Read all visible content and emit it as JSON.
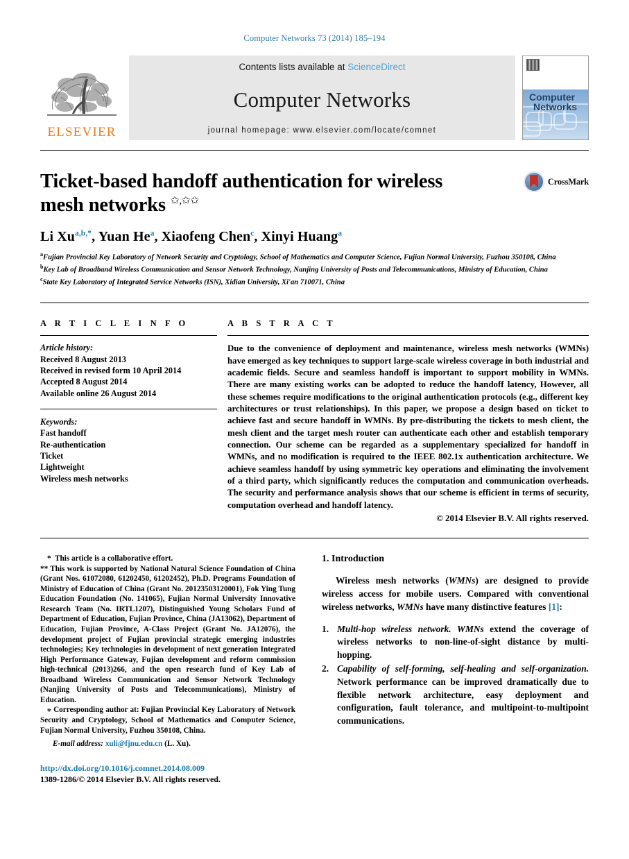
{
  "running_head": "Computer Networks 73 (2014) 185–194",
  "masthead": {
    "contents_prefix": "Contents lists available at ",
    "sciencedirect": "ScienceDirect",
    "journal_title": "Computer Networks",
    "homepage": "journal homepage: www.elsevier.com/locate/comnet",
    "publisher_word": "ELSEVIER",
    "cover_line1": "Computer",
    "cover_line2": "Networks",
    "crossmark_label": "CrossMark"
  },
  "title": {
    "text": "Ticket-based handoff authentication for wireless mesh networks",
    "footnote_marks": "✩,✩✩"
  },
  "authors": [
    {
      "name": "Li Xu",
      "sup": "a,b,",
      "star": "*"
    },
    {
      "name": "Yuan He",
      "sup": "a"
    },
    {
      "name": "Xiaofeng Chen",
      "sup": "c"
    },
    {
      "name": "Xinyi Huang",
      "sup": "a"
    }
  ],
  "affiliations": [
    {
      "mark": "a",
      "text": "Fujian Provincial Key Laboratory of Network Security and Cryptology, School of Mathematics and Computer Science, Fujian Normal University, Fuzhou 350108, China"
    },
    {
      "mark": "b",
      "text": "Key Lab of Broadband Wireless Communication and Sensor Network Technology, Nanjing University of Posts and Telecommunications, Ministry of Education, China"
    },
    {
      "mark": "c",
      "text": "State Key Laboratory of Integrated Service Networks (ISN), Xidian University, Xi'an 710071, China"
    }
  ],
  "article_info": {
    "heading": "A R T I C L E   I N F O",
    "history_label": "Article history:",
    "history": [
      "Received 8 August 2013",
      "Received in revised form 10 April 2014",
      "Accepted 8 August 2014",
      "Available online 26 August 2014"
    ],
    "keywords_label": "Keywords:",
    "keywords": [
      "Fast handoff",
      "Re-authentication",
      "Ticket",
      "Lightweight",
      "Wireless mesh networks"
    ]
  },
  "abstract": {
    "heading": "A B S T R A C T",
    "text": "Due to the convenience of deployment and maintenance, wireless mesh networks (WMNs) have emerged as key techniques to support large-scale wireless coverage in both industrial and academic fields. Secure and seamless handoff is important to support mobility in WMNs. There are many existing works can be adopted to reduce the handoff latency, However, all these schemes require modifications to the original authentication protocols (e.g., different key architectures or trust relationships). In this paper, we propose a design based on ticket to achieve fast and secure handoff in WMNs. By pre-distributing the tickets to mesh client, the mesh client and the target mesh router can authenticate each other and establish temporary connection. Our scheme can be regarded as a supplementary specialized for handoff in WMNs, and no modification is required to the IEEE 802.1x authentication architecture. We achieve seamless handoff by using symmetric key operations and eliminating the involvement of a third party, which significantly reduces the computation and communication overheads. The security and performance analysis shows that our scheme is efficient in terms of security, computation overhead and handoff latency.",
    "copyright": "© 2014 Elsevier B.V. All rights reserved."
  },
  "footnotes": {
    "star_mark": "*",
    "star_text": "This article is a collaborative effort.",
    "dstar_mark": "**",
    "dstar_text": "This work is supported by National Natural Science Foundation of China (Grant Nos. 61072080, 61202450, 61202452), Ph.D. Programs Foundation of Ministry of Education of China (Grant No. 20123503120001), Fok Ying Tung Education Foundation (No. 141065), Fujian Normal University Innovative Research Team (No. IRTL1207), Distinguished Young Scholars Fund of Department of Education, Fujian Province, China (JA13062), Department of Education, Fujian Province, A-Class Project (Grant No. JA12076), the development project of Fujian provincial strategic emerging industries technologies; Key technologies in development of next generation Integrated High Performance Gateway, Fujian development and reform commission high-technical (2013)266, and the open research fund of Key Lab of Broadband Wireless Communication and Sensor Network Technology (Nanjing University of Posts and Telecommunications), Ministry of Education.",
    "corresponding_mark": "⁎",
    "corresponding_text": "Corresponding author at: Fujian Provincial Key Laboratory of Network Security and Cryptology, School of Mathematics and Computer Science, Fujian Normal University, Fuzhou 350108, China.",
    "email_label": "E-mail address:",
    "email": "xuli@fjnu.edu.cn",
    "email_suffix": "(L. Xu)."
  },
  "doi": "http://dx.doi.org/10.1016/j.comnet.2014.08.009",
  "issn_line": "1389-1286/© 2014 Elsevier B.V. All rights reserved.",
  "introduction": {
    "heading": "1. Introduction",
    "para1_a": "Wireless mesh networks (",
    "para1_i1": "WMNs",
    "para1_b": ") are designed to provide wireless access for mobile users. Compared with conventional wireless networks, ",
    "para1_i2": "WMNs",
    "para1_c": " have many distinctive features ",
    "para1_ref": "[1]",
    "para1_d": ":",
    "items": [
      {
        "n": "1.",
        "italic": "Multi-hop wireless network.",
        "rest_a": " ",
        "rest_i": "WMNs",
        "rest_b": " extend the coverage of wireless networks to non-line-of-sight distance by multi-hopping."
      },
      {
        "n": "2.",
        "italic": "Capability of self-forming, self-healing and self-organization.",
        "rest_a": " Network performance can be improved dramatically due to flexible network architecture, easy deployment and configuration, fault tolerance, and multipoint-to-multipoint communications.",
        "rest_i": "",
        "rest_b": ""
      }
    ]
  },
  "colors": {
    "link_blue": "#1a7bab",
    "header_blue": "#2e7ca6",
    "elsevier_orange": "#ef7d1a",
    "band_gray": "#e7e7e7"
  }
}
